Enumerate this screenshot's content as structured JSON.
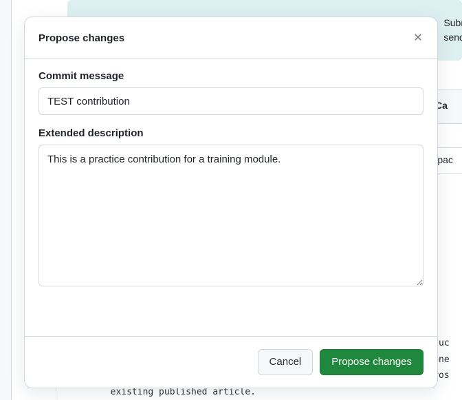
{
  "background": {
    "banner_line1": "Subm",
    "banner_line2": "send",
    "toolbar_right1": "Ca",
    "toolbar_right2": "Spac",
    "code_line1": "                                                                  roduc",
    "code_line2": "                                                                  ryone",
    "code_line3": "                                                                  icros",
    "code_line4": "        existing published article."
  },
  "modal": {
    "title": "Propose changes",
    "commit_message": {
      "label": "Commit message",
      "value": "TEST contribution"
    },
    "extended_description": {
      "label": "Extended description",
      "value": "This is a practice contribution for a training module."
    },
    "actions": {
      "cancel": "Cancel",
      "submit": "Propose changes"
    }
  }
}
